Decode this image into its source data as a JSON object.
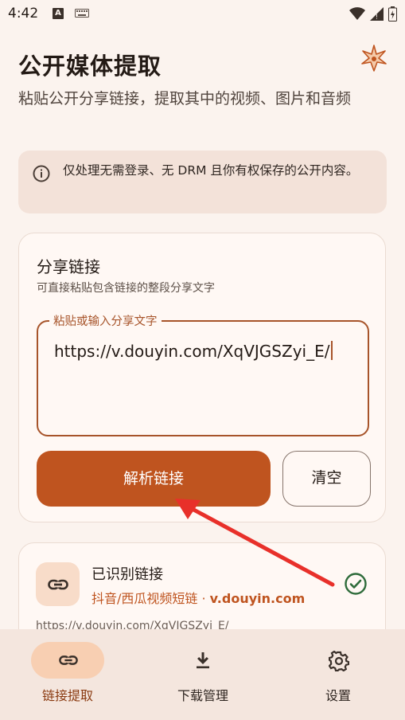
{
  "status_bar": {
    "time": "4:42",
    "notification_icon_letter": "A"
  },
  "header": {
    "title": "公开媒体提取",
    "subtitle": "粘贴公开分享链接，提取其中的视频、图片和音频",
    "icon": "sparkle-icon"
  },
  "notice": {
    "icon": "info-icon",
    "text": "仅处理无需登录、无 DRM 且你有权保存的公开内容。"
  },
  "share_card": {
    "title": "分享链接",
    "hint": "可直接粘贴包含链接的整段分享文字",
    "input_label": "粘贴或输入分享文字",
    "input_value": "https://v.douyin.com/XqVJGSZyi_E/",
    "parse_button": "解析链接",
    "clear_button": "清空"
  },
  "recognized": {
    "title": "已识别链接",
    "platform": "抖音/西瓜视频短链",
    "separator": " · ",
    "domain": "v.douyin.com",
    "url": "https://v.douyin.com/XqVJGSZyi_E/",
    "status_icon": "check-circle-icon"
  },
  "bottom_nav": {
    "items": [
      {
        "label": "链接提取",
        "icon": "link-icon",
        "active": true
      },
      {
        "label": "下载管理",
        "icon": "download-icon",
        "active": false
      },
      {
        "label": "设置",
        "icon": "gear-icon",
        "active": false
      }
    ]
  },
  "colors": {
    "background": "#fbf3ee",
    "accent": "#bf541f",
    "success": "#2e6b3a",
    "annotation_arrow": "#e8302a"
  }
}
